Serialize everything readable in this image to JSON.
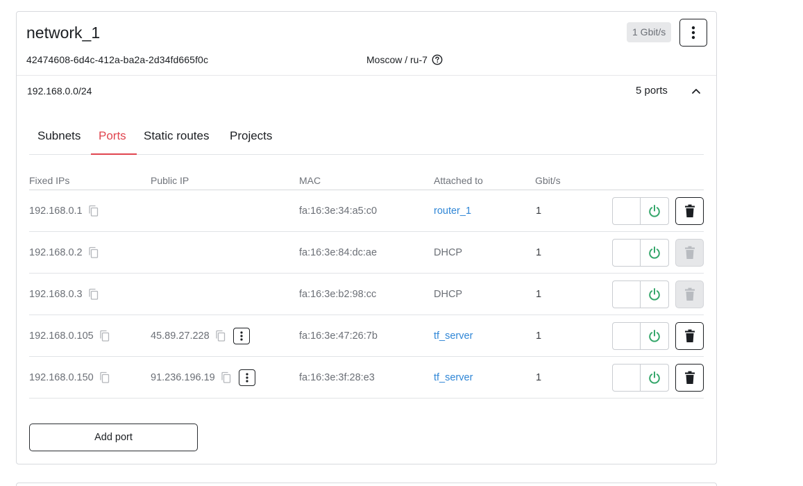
{
  "network": {
    "name": "network_1",
    "speed_badge": "1 Gbit/s",
    "id": "42474608-6d4c-412a-ba2a-2d34fd665f0c",
    "region": "Moscow / ru-7"
  },
  "subnet": {
    "cidr": "192.168.0.0/24",
    "ports_count": "5 ports"
  },
  "tabs": [
    {
      "label": "Subnets",
      "active": false
    },
    {
      "label": "Ports",
      "active": true
    },
    {
      "label": "Static routes",
      "active": false
    },
    {
      "label": "Projects",
      "active": false
    }
  ],
  "table": {
    "headers": {
      "fixed_ips": "Fixed IPs",
      "public_ip": "Public IP",
      "mac": "MAC",
      "attached_to": "Attached to",
      "gbits": "Gbit/s"
    },
    "rows": [
      {
        "fixed_ip": "192.168.0.1",
        "public_ip": "",
        "mac": "fa:16:3e:34:a5:c0",
        "attached_to": "router_1",
        "gbits": "1",
        "delete_enabled": true
      },
      {
        "fixed_ip": "192.168.0.2",
        "public_ip": "",
        "mac": "fa:16:3e:84:dc:ae",
        "attached_to": "DHCP",
        "gbits": "1",
        "delete_enabled": false
      },
      {
        "fixed_ip": "192.168.0.3",
        "public_ip": "",
        "mac": "fa:16:3e:b2:98:cc",
        "attached_to": "DHCP",
        "gbits": "1",
        "delete_enabled": false
      },
      {
        "fixed_ip": "192.168.0.105",
        "public_ip": "45.89.27.228",
        "mac": "fa:16:3e:47:26:7b",
        "attached_to": "tf_server",
        "gbits": "1",
        "delete_enabled": true
      },
      {
        "fixed_ip": "192.168.0.150",
        "public_ip": "91.236.196.19",
        "mac": "fa:16:3e:3f:28:e3",
        "attached_to": "tf_server",
        "gbits": "1",
        "delete_enabled": true
      }
    ]
  },
  "actions": {
    "add_port_label": "Add port"
  },
  "colors": {
    "accent_active_tab": "#e0454f",
    "link": "#2f86d6",
    "power_icon": "#34a66a",
    "disabled_trash": "#b8bbc0"
  }
}
